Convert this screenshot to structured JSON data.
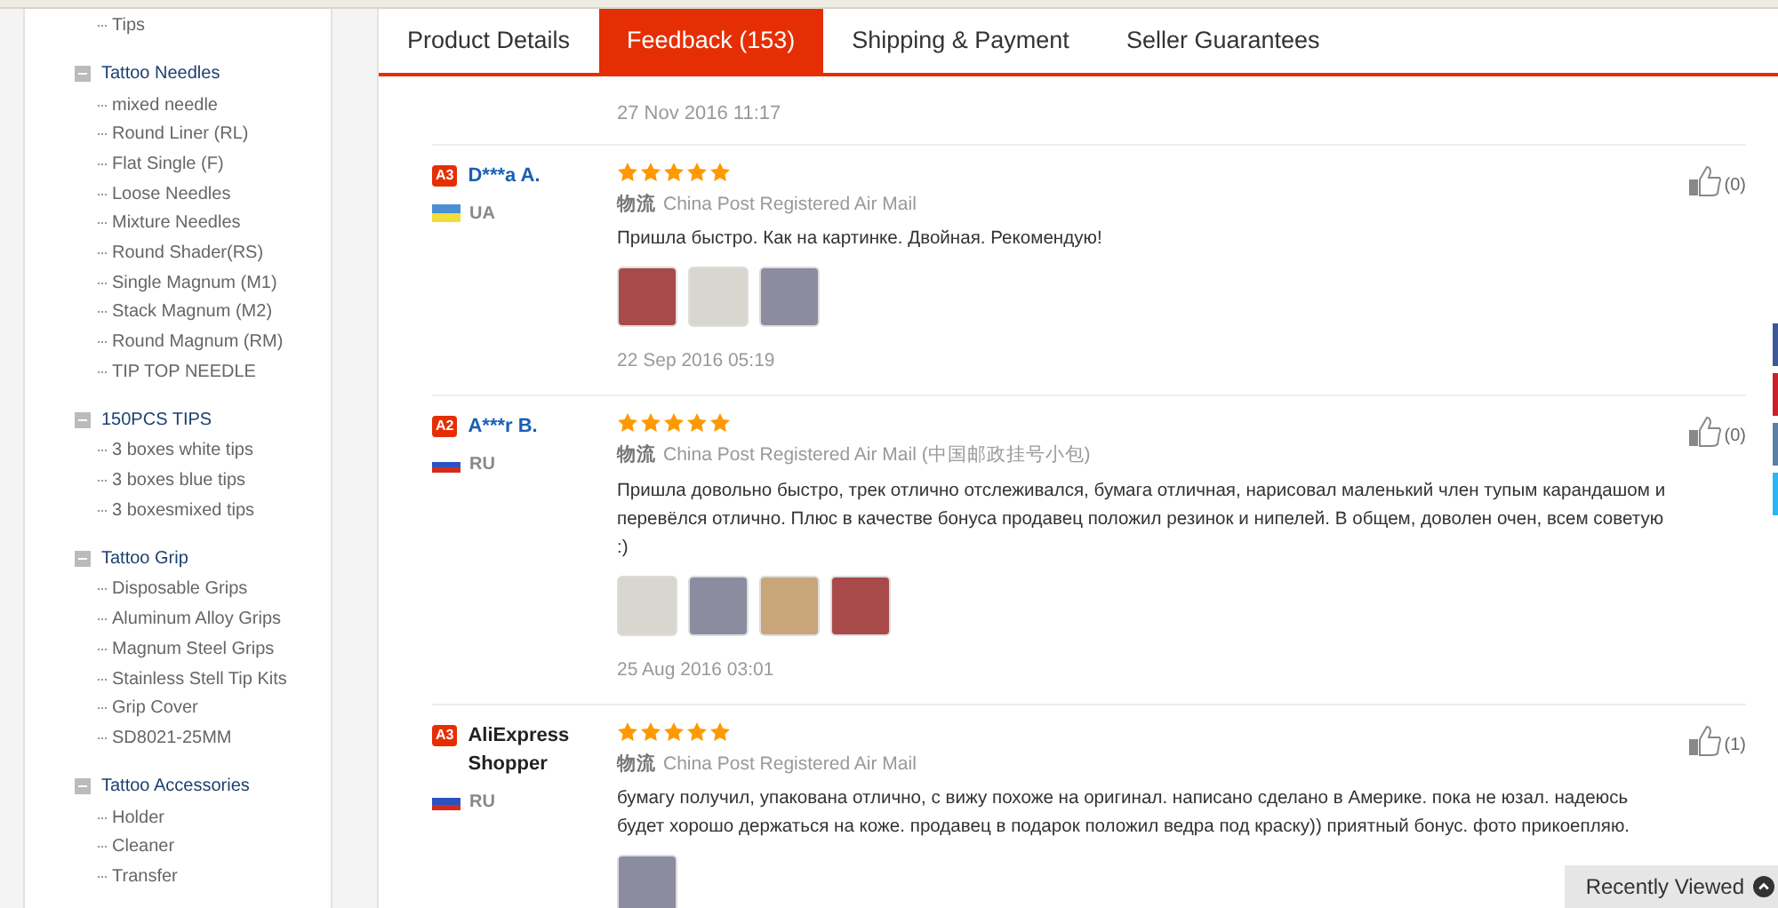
{
  "sidebar": {
    "groups": [
      {
        "children": [
          "Tips"
        ]
      },
      {
        "title": "Tattoo Needles",
        "expanded": true,
        "children": [
          "mixed needle",
          "Round Liner (RL)",
          "Flat Single (F)",
          "Loose Needles",
          "Mixture Needles",
          "Round Shader(RS)",
          "Single Magnum (M1)",
          "Stack Magnum (M2)",
          "Round Magnum (RM)",
          "TIP TOP NEEDLE"
        ]
      },
      {
        "title": "150PCS TIPS",
        "expanded": true,
        "children": [
          "3 boxes white tips",
          "3 boxes blue tips",
          "3 boxesmixed tips"
        ]
      },
      {
        "title": "Tattoo Grip",
        "expanded": true,
        "children": [
          "Disposable Grips",
          "Aluminum Alloy Grips",
          "Magnum Steel Grips",
          "Stainless Stell Tip Kits",
          "Grip Cover",
          "SD8021-25MM"
        ]
      },
      {
        "title": "Tattoo Accessories",
        "expanded": true,
        "children": [
          "Holder",
          "Cleaner",
          "Transfer"
        ]
      }
    ]
  },
  "tabs": [
    {
      "label": "Product Details",
      "selected": false
    },
    {
      "label": "Feedback (153)",
      "selected": true
    },
    {
      "label": "Shipping & Payment",
      "selected": false
    },
    {
      "label": "Seller Guarantees",
      "selected": false
    }
  ],
  "previous_review_date": "27 Nov 2016 11:17",
  "reviews": [
    {
      "badge": "A3",
      "name": "D***a A.",
      "flag": {
        "kind": "ua"
      },
      "country": "UA",
      "stars": 5,
      "shipping_label": "物流",
      "shipping": "China Post Registered Air Mail",
      "text": "Пришла быстро. Как на картинке. Двойная. Рекомендую!",
      "photos": [
        {
          "kind": "photo"
        },
        {
          "kind": "photo"
        },
        {
          "kind": "photo"
        }
      ],
      "date": "22 Sep 2016 05:19",
      "likes": "(0)"
    },
    {
      "badge": "A2",
      "name": "A***r B.",
      "flag": {
        "kind": "ru"
      },
      "country": "RU",
      "stars": 5,
      "shipping_label": "物流",
      "shipping": "China Post Registered Air Mail (中国邮政挂号小包)",
      "text": "Пришла довольно быстро, трек отлично отслеживался, бумага отличная, нарисовал маленький член тупым карандашом и перевёлся отлично. Плюс в качестве бонуса продавец положил резинок и нипелей. В общем, доволен очен, всем советую :)",
      "photos": [
        {
          "kind": "photo"
        },
        {
          "kind": "photo"
        },
        {
          "kind": "photo"
        },
        {
          "kind": "photo"
        }
      ],
      "date": "25 Aug 2016 03:01",
      "likes": "(0)"
    },
    {
      "badge": "A3",
      "name": "AliExpress Shopper",
      "flag": {
        "kind": "ru"
      },
      "country": "RU",
      "stars": 5,
      "shipping_label": "物流",
      "shipping": "China Post Registered Air Mail",
      "text": "бумагу получил, упакована отлично, с вижу похоже на оригинал. написано сделано в Америке. пока не юзал. надеюсь будет хорошо держаться на коже. продавец в подарок положил ведра под краску)) приятный бонус. фото прикоепляю.",
      "photos": [
        {
          "kind": "photo"
        }
      ],
      "likes": "(1)"
    }
  ],
  "recently_viewed": "Recently Viewed"
}
